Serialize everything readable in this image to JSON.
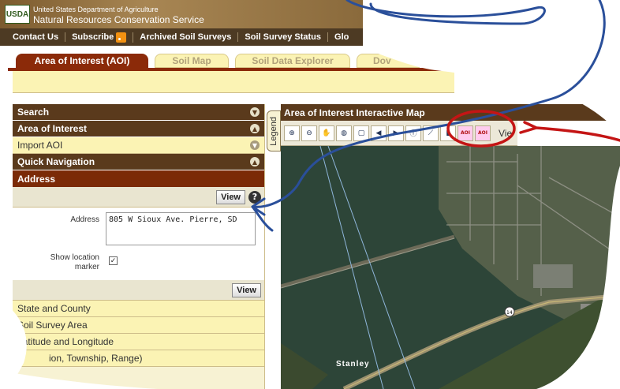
{
  "header": {
    "logo_text": "USDA",
    "line1": "United States Department of Agriculture",
    "line2": "Natural Resources Conservation Service"
  },
  "nav": {
    "items": [
      "Contact Us",
      "Subscribe",
      "Archived Soil Surveys",
      "Soil Survey Status",
      "Glo"
    ]
  },
  "tabs": {
    "aoi": "Area of Interest (AOI)",
    "soil_map": "Soil Map",
    "soil_data_explorer": "Soil Data Explorer",
    "download": "Dov"
  },
  "left_panel": {
    "search": "Search",
    "area_of_interest": "Area of Interest",
    "import_aoi": "Import AOI",
    "quick_navigation": "Quick Navigation",
    "address_header": "Address",
    "view_label": "View",
    "help_symbol": "?",
    "address_label": "Address",
    "address_value": "805 W Sioux Ave. Pierre, SD",
    "show_location_label_1": "Show location",
    "show_location_label_2": "marker",
    "checkbox_mark": "✓",
    "view_label_2": "View",
    "state_and_county": "State and County",
    "soil_survey_area": "Soil Survey Area",
    "lat_long": "Latitude and Longitude",
    "plss": "ion, Township, Range)"
  },
  "legend": {
    "label": "Legend"
  },
  "map": {
    "title": "Area of Interest Interactive Map",
    "toolbar_label": "Vie",
    "aoi_label": "AOI",
    "place_label": "Stanley"
  },
  "colors": {
    "brown_header": "#5a3a1c",
    "accent_red": "#8b2a09",
    "cream": "#fbf3b4",
    "annotation_blue": "#2a4f9a",
    "annotation_red": "#c41515"
  }
}
